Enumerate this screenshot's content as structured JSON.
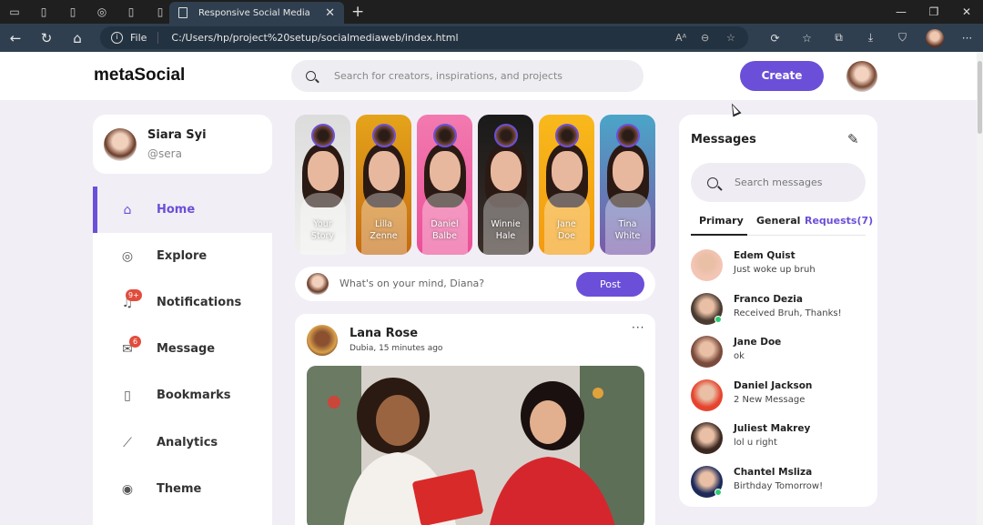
{
  "browser": {
    "tab_title": "Responsive Social Media",
    "address_prefix": "File",
    "url": "C:/Users/hp/project%20setup/socialmediaweb/index.html",
    "read_aloud": "Aᴬ"
  },
  "app": {
    "logo": "metaSocial",
    "search_placeholder": "Search for creators, inspirations, and projects",
    "create_label": "Create"
  },
  "profile": {
    "name": "Siara Syi",
    "handle": "@sera"
  },
  "sidebar": {
    "items": [
      {
        "label": "Home",
        "icon": "home-icon"
      },
      {
        "label": "Explore",
        "icon": "compass-icon"
      },
      {
        "label": "Notifications",
        "icon": "bell-icon",
        "badge": "9+"
      },
      {
        "label": "Message",
        "icon": "envelope-icon",
        "badge": "6"
      },
      {
        "label": "Bookmarks",
        "icon": "bookmark-icon"
      },
      {
        "label": "Analytics",
        "icon": "chart-icon"
      },
      {
        "label": "Theme",
        "icon": "palette-icon"
      }
    ]
  },
  "stories": [
    {
      "line1": "Your",
      "line2": "Story",
      "colors": [
        "#dcdcdc",
        "#f0f0ee"
      ]
    },
    {
      "line1": "Lilla",
      "line2": "Zenne",
      "colors": [
        "#e5a41a",
        "#c46a10"
      ]
    },
    {
      "line1": "Daniel",
      "line2": "Balbe",
      "colors": [
        "#f27ab0",
        "#ec4f97"
      ]
    },
    {
      "line1": "Winnie",
      "line2": "Hale",
      "colors": [
        "#1a1a1a",
        "#3a2e28"
      ]
    },
    {
      "line1": "Jane",
      "line2": "Doe",
      "colors": [
        "#f8b91c",
        "#f39a0e"
      ]
    },
    {
      "line1": "Tina",
      "line2": "White",
      "colors": [
        "#4aa5c8",
        "#7a5aa8"
      ]
    }
  ],
  "create_post": {
    "placeholder": "What's on your mind, Diana?",
    "button": "Post"
  },
  "feed": {
    "name": "Lana Rose",
    "meta": "Dubia, 15 minutes ago",
    "more": "···"
  },
  "messages": {
    "title": "Messages",
    "search_placeholder": "Search messages",
    "tabs": [
      "Primary",
      "General",
      "Requests(7)"
    ],
    "chats": [
      {
        "name": "Edem Quist",
        "text": "Just woke up bruh",
        "online": false,
        "bg": "#f3c5b5"
      },
      {
        "name": "Franco Dezia",
        "text": "Received Bruh, Thanks!",
        "online": true,
        "bg": "#4a3a30"
      },
      {
        "name": "Jane Doe",
        "text": "ok",
        "online": false,
        "bg": "#7a4a3c"
      },
      {
        "name": "Daniel Jackson",
        "text": "2 New Message",
        "online": false,
        "bg": "#e5452f"
      },
      {
        "name": "Juliest Makrey",
        "text": "lol u right",
        "online": false,
        "bg": "#3b2820"
      },
      {
        "name": "Chantel Msliza",
        "text": "Birthday Tomorrow!",
        "online": true,
        "bg": "#1c2a5a"
      }
    ]
  },
  "colors": {
    "accent": "#6b4fd8",
    "badge": "#e14d3d",
    "online": "#2ecc71"
  }
}
